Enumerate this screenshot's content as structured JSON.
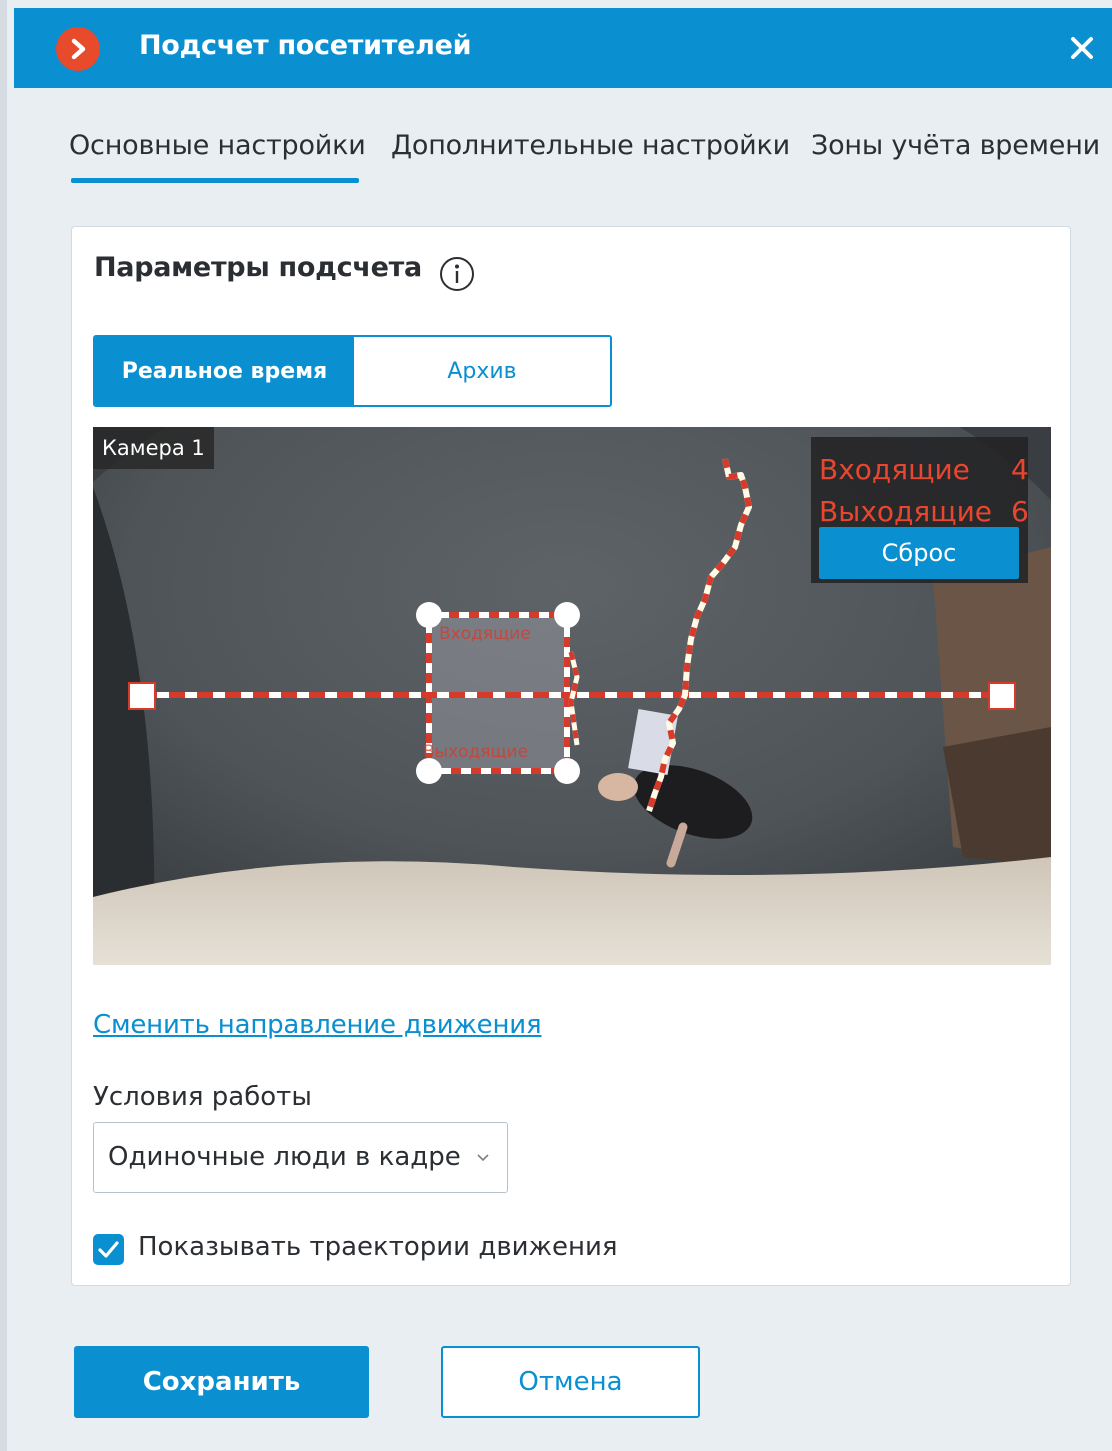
{
  "window": {
    "title": "Подсчет посетителей"
  },
  "tabs": [
    {
      "label": "Основные настройки",
      "active": true
    },
    {
      "label": "Дополнительные настройки",
      "active": false
    },
    {
      "label": "Зоны учёта времени",
      "active": false
    }
  ],
  "section": {
    "title": "Параметры подсчета"
  },
  "mode": {
    "realtime_label": "Реальное время",
    "archive_label": "Архив",
    "selected": "Реальное время"
  },
  "video": {
    "camera_label": "Камера 1",
    "counters": {
      "incoming_label": "Входящие",
      "incoming_value": "4",
      "outgoing_label": "Выходящие",
      "outgoing_value": "6",
      "reset_label": "Сброс"
    },
    "zone_labels": {
      "top": "Входящие",
      "bottom": "Выходящие"
    }
  },
  "change_direction_link": "Сменить направление движения",
  "conditions": {
    "label": "Условия работы",
    "value": "Одиночные люди в кадре"
  },
  "show_trajectories": {
    "label": "Показывать траектории движения",
    "checked": true
  },
  "footer": {
    "save_label": "Сохранить",
    "cancel_label": "Отмена"
  },
  "colors": {
    "accent": "#0a8fd1",
    "counter_text": "#e8462e",
    "logo": "#e84a2c"
  }
}
